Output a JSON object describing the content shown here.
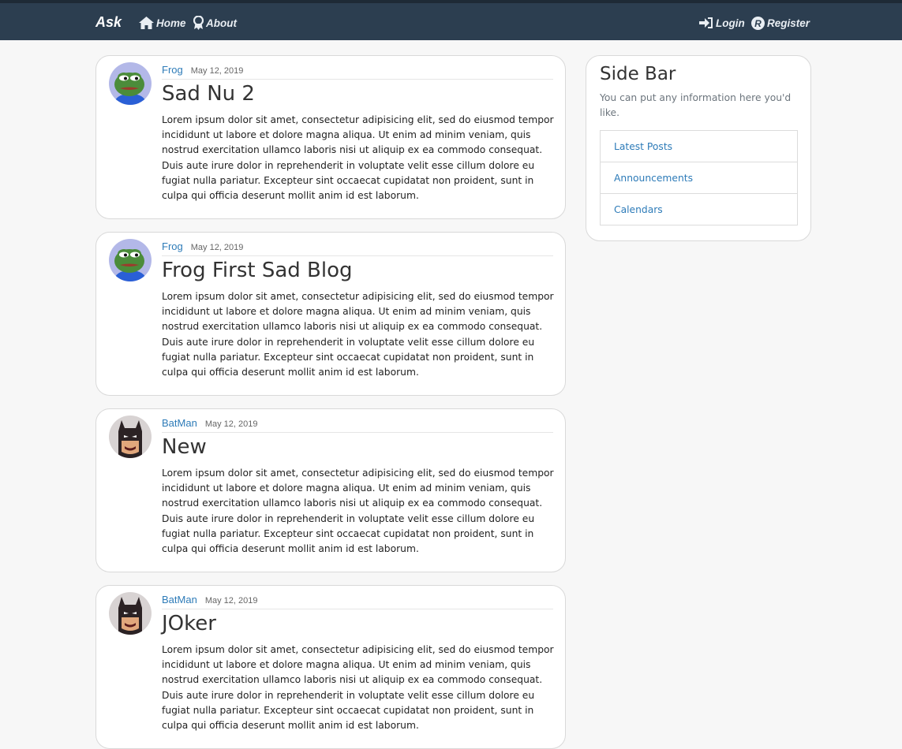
{
  "nav": {
    "brand": "Ask",
    "home_label": "Home",
    "about_label": "About",
    "login_label": "Login",
    "register_label": "Register",
    "bg_color": "#2c3e50"
  },
  "posts": [
    {
      "author": "Frog",
      "date": "May 12, 2019",
      "title": "Sad Nu 2",
      "avatar": "pepe-frog-avatar",
      "body": "Lorem ipsum dolor sit amet, consectetur adipisicing elit, sed do eiusmod tempor incididunt ut labore et dolore magna aliqua. Ut enim ad minim veniam, quis nostrud exercitation ullamco laboris nisi ut aliquip ex ea commodo consequat. Duis aute irure dolor in reprehenderit in voluptate velit esse cillum dolore eu fugiat nulla pariatur. Excepteur sint occaecat cupidatat non proident, sunt in culpa qui officia deserunt mollit anim id est laborum."
    },
    {
      "author": "Frog",
      "date": "May 12, 2019",
      "title": "Frog First Sad Blog",
      "avatar": "pepe-frog-avatar",
      "body": "Lorem ipsum dolor sit amet, consectetur adipisicing elit, sed do eiusmod tempor incididunt ut labore et dolore magna aliqua. Ut enim ad minim veniam, quis nostrud exercitation ullamco laboris nisi ut aliquip ex ea commodo consequat. Duis aute irure dolor in reprehenderit in voluptate velit esse cillum dolore eu fugiat nulla pariatur. Excepteur sint occaecat cupidatat non proident, sunt in culpa qui officia deserunt mollit anim id est laborum."
    },
    {
      "author": "BatMan",
      "date": "May 12, 2019",
      "title": "New",
      "avatar": "lego-batman-avatar",
      "body": "Lorem ipsum dolor sit amet, consectetur adipisicing elit, sed do eiusmod tempor incididunt ut labore et dolore magna aliqua. Ut enim ad minim veniam, quis nostrud exercitation ullamco laboris nisi ut aliquip ex ea commodo consequat. Duis aute irure dolor in reprehenderit in voluptate velit esse cillum dolore eu fugiat nulla pariatur. Excepteur sint occaecat cupidatat non proident, sunt in culpa qui officia deserunt mollit anim id est laborum."
    },
    {
      "author": "BatMan",
      "date": "May 12, 2019",
      "title": "JOker",
      "avatar": "lego-batman-avatar",
      "body": "Lorem ipsum dolor sit amet, consectetur adipisicing elit, sed do eiusmod tempor incididunt ut labore et dolore magna aliqua. Ut enim ad minim veniam, quis nostrud exercitation ullamco laboris nisi ut aliquip ex ea commodo consequat. Duis aute irure dolor in reprehenderit in voluptate velit esse cillum dolore eu fugiat nulla pariatur. Excepteur sint occaecat cupidatat non proident, sunt in culpa qui officia deserunt mollit anim id est laborum."
    }
  ],
  "sidebar": {
    "title": "Side Bar",
    "description": "You can put any information here you'd like.",
    "items": [
      {
        "label": "Latest Posts"
      },
      {
        "label": "Announcements"
      },
      {
        "label": "Calendars"
      }
    ]
  },
  "colors": {
    "link": "#2d7bb8",
    "page_bg": "#f7f7f7"
  }
}
